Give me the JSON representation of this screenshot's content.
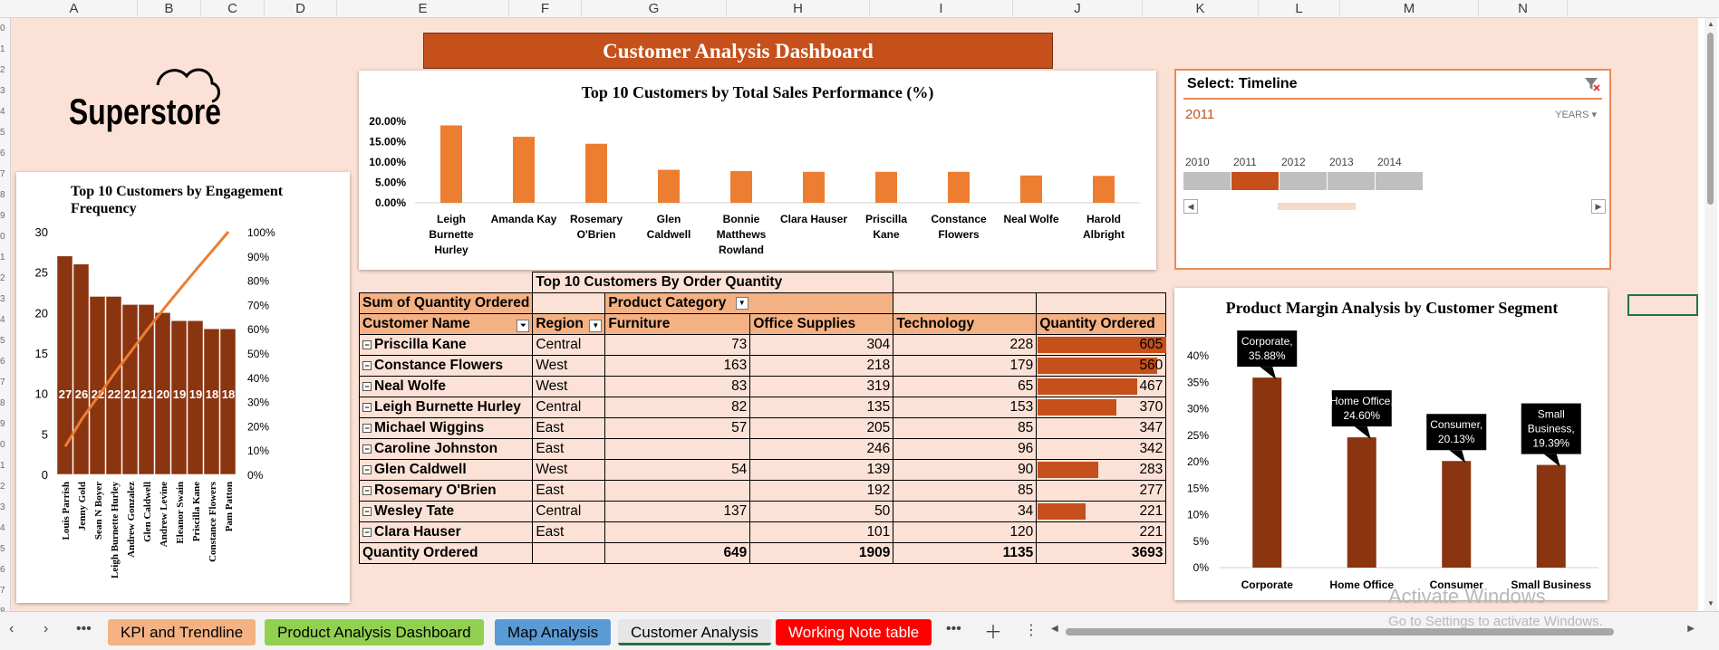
{
  "columns": [
    "A",
    "B",
    "C",
    "D",
    "E",
    "F",
    "G",
    "H",
    "I",
    "J",
    "K",
    "L",
    "M",
    "N"
  ],
  "rows": [
    "0",
    "1",
    "2",
    "3",
    "4",
    "5",
    "6",
    "7",
    "8",
    "9",
    "0",
    "1",
    "2",
    "3",
    "4",
    "5",
    "6",
    "7",
    "8",
    "9",
    "0",
    "1",
    "2",
    "3",
    "4",
    "5",
    "6",
    "7",
    "8",
    "9"
  ],
  "dashboard": {
    "title": "Customer Analysis Dashboard",
    "logo_text": "Superstore"
  },
  "pareto_chart": {
    "title": "Top 10 Customers by Engagement Frequency",
    "chart_data": {
      "type": "bar",
      "categories": [
        "Louis Parrish",
        "Jenny Gold",
        "Sean N Boyer",
        "Leigh Burnette Hurley",
        "Andrew Gonzalez",
        "Glen Caldwell",
        "Andrew Levine",
        "Eleanor Swain",
        "Priscilla Kane",
        "Constance Flowers",
        "Pam Patton"
      ],
      "values": [
        27,
        26,
        22,
        22,
        21,
        21,
        20,
        19,
        19,
        18,
        18
      ],
      "ylim": [
        0,
        30
      ],
      "yticks": [
        "0",
        "5",
        "10",
        "15",
        "20",
        "25",
        "30"
      ],
      "y2ticks": [
        "0%",
        "10%",
        "20%",
        "30%",
        "40%",
        "50%",
        "60%",
        "70%",
        "80%",
        "90%",
        "100%"
      ],
      "cumulative_pct": [
        11.5,
        22.6,
        32.0,
        41.5,
        50.4,
        59.4,
        67.9,
        76.1,
        84.2,
        92.1,
        100
      ],
      "bar_color": "#8b3410",
      "line_color": "#ed7d31"
    }
  },
  "sales_chart": {
    "title": "Top 10 Customers by Total Sales Performance (%)",
    "chart_data": {
      "type": "bar",
      "categories": [
        "Leigh Burnette Hurley",
        "Amanda Kay",
        "Rosemary O'Brien",
        "Glen Caldwell",
        "Bonnie Matthews Rowland",
        "Clara Hauser",
        "Priscilla Kane",
        "Constance Flowers",
        "Neal Wolfe",
        "Harold Albright"
      ],
      "label_lines": [
        [
          "Leigh",
          "Burnette",
          "Hurley"
        ],
        [
          "Amanda Kay"
        ],
        [
          "Rosemary",
          "O'Brien"
        ],
        [
          "Glen",
          "Caldwell"
        ],
        [
          "Bonnie",
          "Matthews",
          "Rowland"
        ],
        [
          "Clara Hauser"
        ],
        [
          "Priscilla",
          "Kane"
        ],
        [
          "Constance",
          "Flowers"
        ],
        [
          "Neal Wolfe"
        ],
        [
          "Harold",
          "Albright"
        ]
      ],
      "values": [
        19.0,
        16.2,
        14.5,
        8.1,
        7.8,
        7.6,
        7.6,
        7.6,
        6.7,
        6.6
      ],
      "ylim": [
        0,
        20
      ],
      "yticks": [
        "0.00%",
        "5.00%",
        "10.00%",
        "15.00%",
        "20.00%"
      ],
      "bar_color": "#ed7d31"
    }
  },
  "pivot": {
    "title": "Top 10 Customers By Order Quantity",
    "sum_label": "Sum of Quantity Ordered",
    "product_category_label": "Product Category",
    "headers": [
      "Customer Name",
      "Region",
      "Furniture",
      "Office Supplies",
      "Technology",
      "Quantity Ordered"
    ],
    "rows": [
      {
        "name": "Priscilla Kane",
        "region": "Central",
        "furniture": "73",
        "office": "304",
        "tech": "228",
        "total": "605",
        "value": 605
      },
      {
        "name": "Constance Flowers",
        "region": "West",
        "furniture": "163",
        "office": "218",
        "tech": "179",
        "total": "560",
        "value": 560
      },
      {
        "name": "Neal Wolfe",
        "region": "West",
        "furniture": "83",
        "office": "319",
        "tech": "65",
        "total": "467",
        "value": 467
      },
      {
        "name": "Leigh Burnette Hurley",
        "region": "Central",
        "furniture": "82",
        "office": "135",
        "tech": "153",
        "total": "370",
        "value": 370
      },
      {
        "name": "Michael Wiggins",
        "region": "East",
        "furniture": "57",
        "office": "205",
        "tech": "85",
        "total": "347",
        "value": 347
      },
      {
        "name": "Caroline Johnston",
        "region": "East",
        "furniture": "",
        "office": "246",
        "tech": "96",
        "total": "342",
        "value": 342
      },
      {
        "name": "Glen Caldwell",
        "region": "West",
        "furniture": "54",
        "office": "139",
        "tech": "90",
        "total": "283",
        "value": 283
      },
      {
        "name": "Rosemary O'Brien",
        "region": "East",
        "furniture": "",
        "office": "192",
        "tech": "85",
        "total": "277",
        "value": 277
      },
      {
        "name": "Wesley Tate",
        "region": "Central",
        "furniture": "137",
        "office": "50",
        "tech": "34",
        "total": "221",
        "value": 221
      },
      {
        "name": "Clara Hauser",
        "region": "East",
        "furniture": "",
        "office": "101",
        "tech": "120",
        "total": "221",
        "value": 221
      }
    ],
    "databar_rows": [
      0,
      1,
      2,
      3,
      6,
      8
    ],
    "total_row": {
      "label": "Quantity Ordered",
      "furniture": "649",
      "office": "1909",
      "tech": "1135",
      "total": "3693"
    }
  },
  "timeline": {
    "title": "Select: Timeline",
    "selected": "2011",
    "level": "YEARS",
    "years": [
      "2010",
      "2011",
      "2012",
      "2013",
      "2014"
    ],
    "selected_index": 1
  },
  "margin_chart": {
    "title": "Product Margin Analysis by Customer Segment",
    "chart_data": {
      "type": "bar",
      "categories": [
        "Corporate",
        "Home Office",
        "Consumer",
        "Small Business"
      ],
      "values": [
        35.88,
        24.6,
        20.13,
        19.39
      ],
      "data_labels": [
        [
          "Corporate,",
          "35.88%"
        ],
        [
          "Home Office,",
          "24.60%"
        ],
        [
          "Consumer,",
          "20.13%"
        ],
        [
          "Small",
          "Business,",
          "19.39%"
        ]
      ],
      "ylim": [
        0,
        40
      ],
      "yticks": [
        "0%",
        "5%",
        "10%",
        "15%",
        "20%",
        "25%",
        "30%",
        "35%",
        "40%"
      ],
      "bar_color": "#8b3410"
    }
  },
  "tabs": [
    {
      "label": "KPI and Trendline",
      "bg": "#f4b183",
      "fg": "#000000"
    },
    {
      "label": "Product Analysis Dashboard",
      "bg": "#92d050",
      "fg": "#000000"
    },
    {
      "label": "Map Analysis",
      "bg": "#5b9bd5",
      "fg": "#000000"
    },
    {
      "label": "Customer Analysis",
      "bg": "#e7e6e6",
      "fg": "#000000"
    },
    {
      "label": "Working Note table",
      "bg": "#ff0000",
      "fg": "#ffffff"
    }
  ],
  "watermark": {
    "line1": "Activate Windows",
    "line2": "Go to Settings to activate Windows."
  }
}
